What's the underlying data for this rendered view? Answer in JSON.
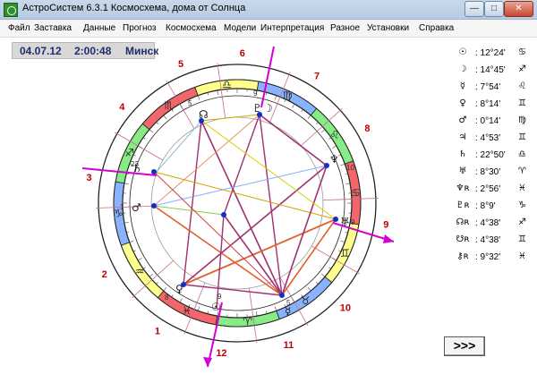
{
  "window": {
    "title": "АстроСистем 6.3.1   Космосхема, дома от Солнца",
    "btn_min": "—",
    "btn_max": "□",
    "btn_close": "✕"
  },
  "menu": [
    "Файл",
    "Заставка",
    "Данные",
    "Прогноз",
    "Космосхема",
    "Модели",
    "Интерпретация",
    "Разное",
    "Установки",
    "Справка"
  ],
  "header": {
    "date": "04.07.12",
    "time": "2:00:48",
    "city": "Минск"
  },
  "planets": [
    {
      "name": "sun",
      "glyph": "☉",
      "degree": ": 12°24'",
      "sign": "♋"
    },
    {
      "name": "moon",
      "glyph": "☽",
      "degree": ": 14°45'",
      "sign": "♐"
    },
    {
      "name": "mercury",
      "glyph": "☿",
      "degree": ": 7°54'",
      "sign": "♌"
    },
    {
      "name": "venus",
      "glyph": "♀",
      "degree": ": 8°14'",
      "sign": "♊"
    },
    {
      "name": "mars",
      "glyph": "♂",
      "degree": ": 0°14'",
      "sign": "♍"
    },
    {
      "name": "jupiter",
      "glyph": "♃",
      "degree": ": 4°53'",
      "sign": "♊"
    },
    {
      "name": "saturn",
      "glyph": "♄",
      "degree": ": 22°50'",
      "sign": "♎"
    },
    {
      "name": "uranus",
      "glyph": "♅",
      "degree": ": 8°30'",
      "sign": "♈"
    },
    {
      "name": "neptune",
      "glyph": "♆ʀ",
      "degree": ": 2°56'",
      "sign": "♓"
    },
    {
      "name": "pluto",
      "glyph": "♇ʀ",
      "degree": ": 8°9'",
      "sign": "♑"
    },
    {
      "name": "north-node",
      "glyph": "☊ʀ",
      "degree": ": 4°38'",
      "sign": "♐"
    },
    {
      "name": "south-node",
      "glyph": "☋ʀ",
      "degree": ": 4°38'",
      "sign": "♊"
    },
    {
      "name": "chiron",
      "glyph": "⚷ʀ",
      "degree": ": 9°32'",
      "sign": "♓"
    }
  ],
  "chart": {
    "house_numbers": [
      "1",
      "2",
      "3",
      "4",
      "5",
      "6",
      "7",
      "8",
      "9",
      "10",
      "11",
      "12"
    ],
    "zodiac_glyphs": [
      "♋",
      "♊",
      "♉",
      "♈",
      "♓",
      "♒",
      "♑",
      "♐",
      "♏",
      "♎",
      "♍",
      "♌"
    ],
    "zodiac_colors": [
      "#f3676b",
      "#ffff8c",
      "#8ab3ff",
      "#87ec87",
      "#f3676b",
      "#ffff8c",
      "#8ab3ff",
      "#87ec87",
      "#f3676b",
      "#ffff8c",
      "#8ab3ff",
      "#87ec87"
    ],
    "inner_degree_labels": [
      "9",
      "5",
      "23",
      "1",
      "8",
      "9",
      "10",
      "5",
      "9"
    ],
    "axis_color": "#d400d4"
  },
  "next_button": ">>>"
}
